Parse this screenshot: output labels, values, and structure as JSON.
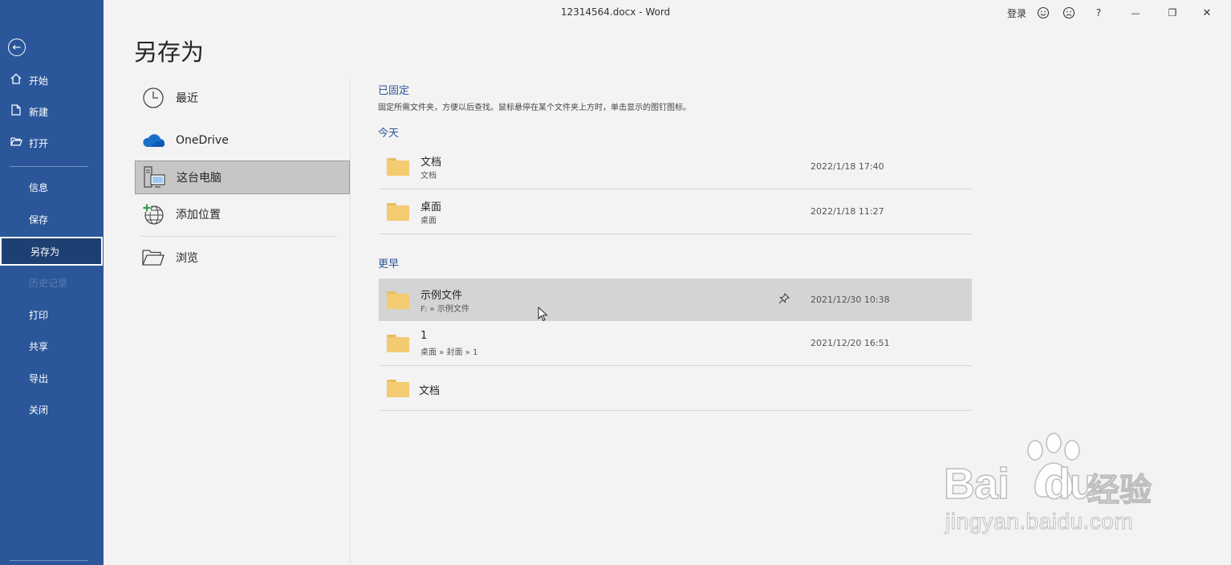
{
  "window": {
    "title": "12314564.docx  -  Word",
    "signin_label": "登录",
    "help_label": "?",
    "minimize_glyph": "—",
    "restore_glyph": "❐",
    "close_glyph": "✕"
  },
  "sidebar": {
    "items": [
      {
        "label": "开始",
        "icon": "home-icon"
      },
      {
        "label": "新建",
        "icon": "new-doc-icon"
      },
      {
        "label": "打开",
        "icon": "open-folder-icon"
      },
      {
        "label": "信息"
      },
      {
        "label": "保存"
      },
      {
        "label": "另存为",
        "active": true
      },
      {
        "label": "历史记录",
        "disabled": true
      },
      {
        "label": "打印"
      },
      {
        "label": "共享"
      },
      {
        "label": "导出"
      },
      {
        "label": "关闭"
      }
    ]
  },
  "page": {
    "title": "另存为"
  },
  "locations": [
    {
      "label": "最近",
      "icon": "clock-icon"
    },
    {
      "label": "OneDrive",
      "icon": "cloud-icon"
    },
    {
      "label": "这台电脑",
      "icon": "computer-icon",
      "selected": true
    },
    {
      "label": "添加位置",
      "icon": "globe-add-icon"
    },
    {
      "label": "浏览",
      "icon": "folder-open-icon"
    }
  ],
  "pinned": {
    "heading": "已固定",
    "description": "固定所需文件夹，方便以后查找。鼠标悬停在某个文件夹上方时，单击显示的图钉图标。"
  },
  "today": {
    "heading": "今天",
    "folders": [
      {
        "name": "文档",
        "path": "文档",
        "date": "2022/1/18 17:40"
      },
      {
        "name": "桌面",
        "path": "桌面",
        "date": "2022/1/18 11:27"
      }
    ]
  },
  "earlier": {
    "heading": "更早",
    "folders": [
      {
        "name": "示例文件",
        "path": "F: » 示例文件",
        "date": "2021/12/30 10:38",
        "hover": true
      },
      {
        "name": "1",
        "path": "桌面 » 封面 » 1",
        "date": "2021/12/20 16:51"
      },
      {
        "name": "文档",
        "path": "",
        "date": ""
      }
    ]
  },
  "watermark": {
    "brand": "Bai",
    "brand_tail": "du",
    "cn": "经验",
    "url": "jingyan.baidu.com"
  },
  "colors": {
    "sidebar": "#2b579a",
    "accent": "#2b579a",
    "folder": "#f3cb70"
  }
}
